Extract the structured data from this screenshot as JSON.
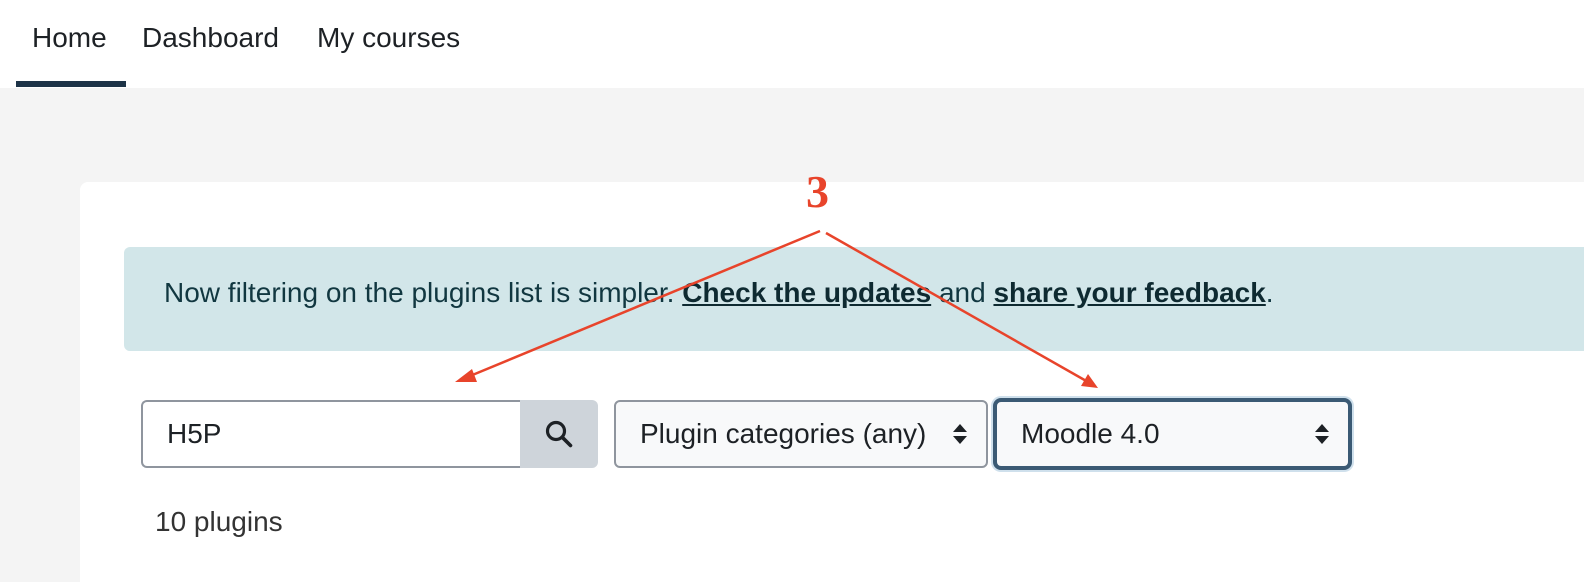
{
  "nav": {
    "home": "Home",
    "dashboard": "Dashboard",
    "my_courses": "My courses",
    "active": "Home"
  },
  "alert": {
    "prefix": "Now filtering on the plugins list is simpler. ",
    "link1": "Check the updates",
    "middle": " and ",
    "link2": "share your feedback",
    "suffix": "."
  },
  "search": {
    "value": "H5P",
    "icon": "search-icon"
  },
  "filters": {
    "categories_label": "Plugin categories (any)",
    "version_label": "Moodle 4.0"
  },
  "results": {
    "count_text": "10 plugins"
  },
  "annotation": {
    "number": "3",
    "color": "#e8442b"
  },
  "colors": {
    "alert_bg": "#d2e6e9",
    "nav_active": "#1d3347",
    "focus_border": "#3b5a74"
  }
}
